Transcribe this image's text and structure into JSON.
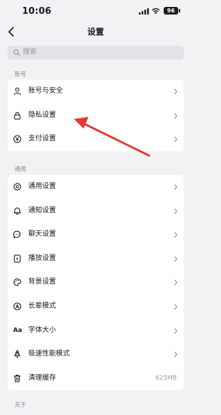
{
  "status": {
    "time": "10:06",
    "battery": "96"
  },
  "nav": {
    "title": "设置",
    "back_icon": "chevron-left-icon"
  },
  "search": {
    "placeholder": "搜索",
    "icon": "search-icon"
  },
  "sections": [
    {
      "title": "账号",
      "items": [
        {
          "label": "账号与安全",
          "icon": "user-icon"
        },
        {
          "label": "隐私设置",
          "icon": "lock-icon"
        },
        {
          "label": "支付设置",
          "icon": "yuan-coin-icon"
        }
      ]
    },
    {
      "title": "通用",
      "items": [
        {
          "label": "通用设置",
          "icon": "gear-icon"
        },
        {
          "label": "通知设置",
          "icon": "bell-icon"
        },
        {
          "label": "聊天设置",
          "icon": "chat-bubble-icon"
        },
        {
          "label": "播放设置",
          "icon": "play-icon"
        },
        {
          "label": "背景设置",
          "icon": "palette-icon"
        },
        {
          "label": "长辈模式",
          "icon": "elder-mode-icon"
        },
        {
          "label": "字体大小",
          "icon": "font-size-icon",
          "glyph": "Aa"
        },
        {
          "label": "极速性能模式",
          "icon": "rocket-icon"
        },
        {
          "label": "清理缓存",
          "icon": "trash-icon",
          "value": "625MB"
        }
      ]
    },
    {
      "title": "关于",
      "items": []
    }
  ],
  "colors": {
    "background": "#f2f2f4",
    "card": "#ffffff",
    "annotation_arrow": "#e8373a"
  }
}
